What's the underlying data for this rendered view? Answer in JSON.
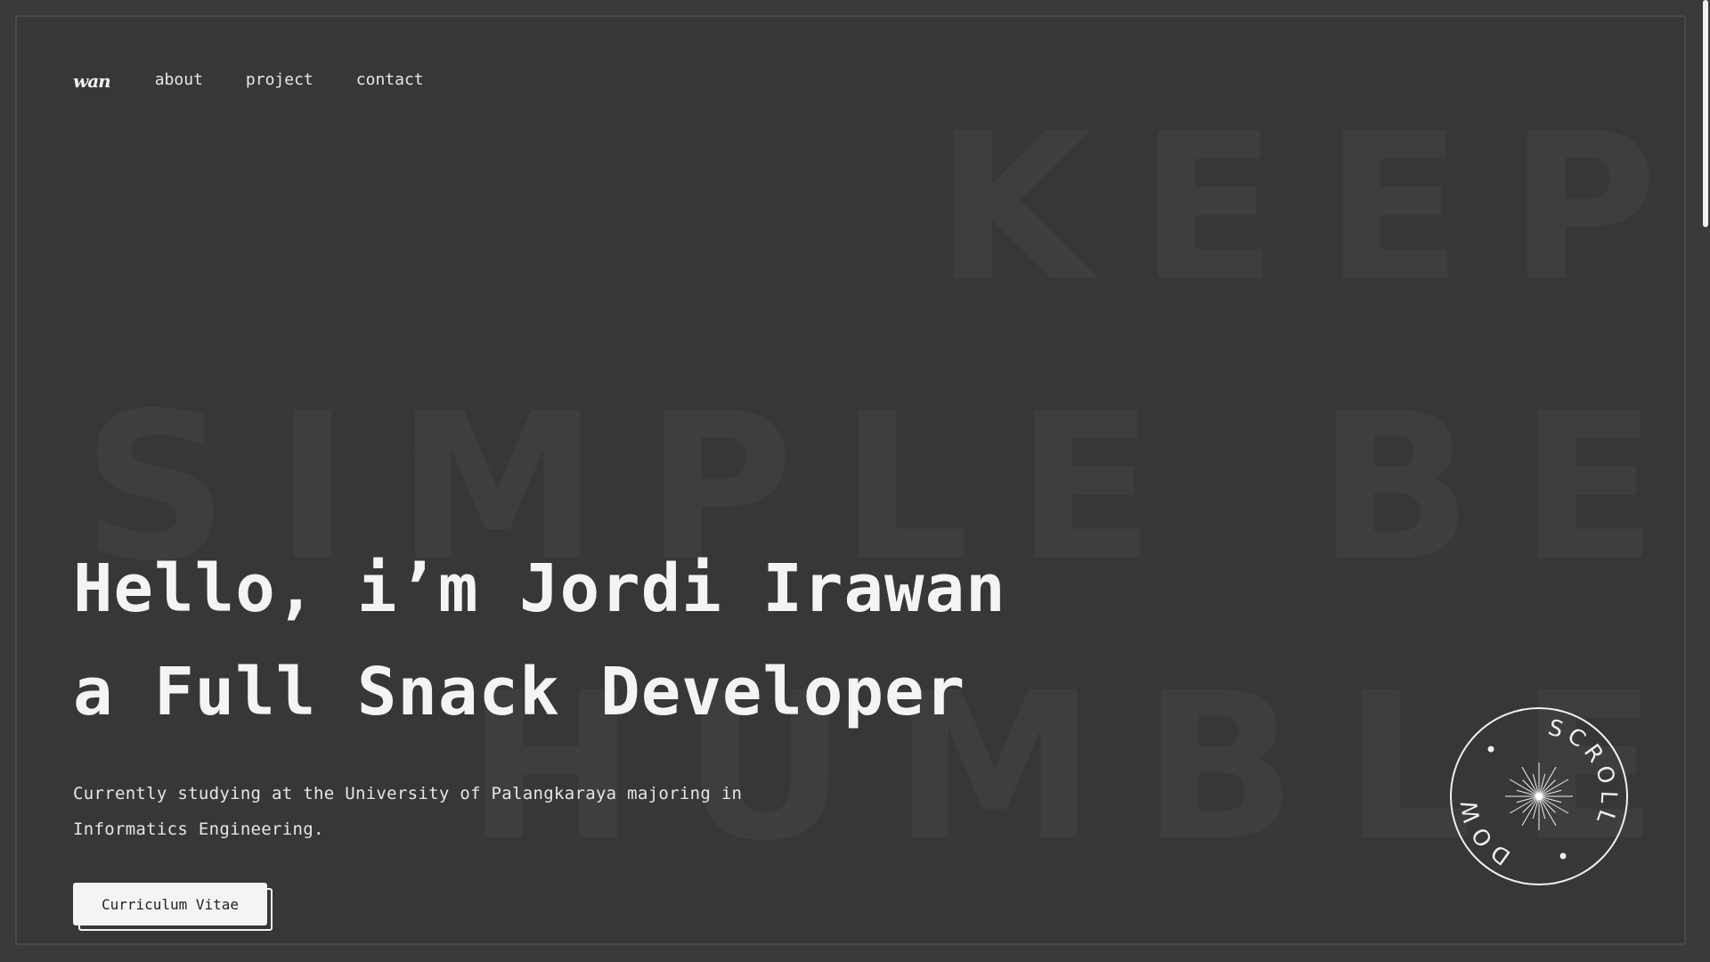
{
  "nav": {
    "logo": "wan",
    "links": [
      "about",
      "project",
      "contact"
    ]
  },
  "background_text": {
    "line1": "KEEP",
    "line2": "SIMPLE BE",
    "line3": "HUMBLE"
  },
  "hero": {
    "line1": "Hello, i’m Jordi Irawan",
    "line2": "a Full Snack Developer",
    "subtitle": "Currently studying at the University of Palangkaraya majoring in Informatics Engineering.",
    "cv_button": "Curriculum Vitae"
  },
  "scroll_badge": {
    "text": "SCROLL",
    "text2": "DOWN"
  },
  "colors": {
    "background": "#373737",
    "text": "#f4f4f4",
    "faded_text": "#3e3e3e"
  }
}
